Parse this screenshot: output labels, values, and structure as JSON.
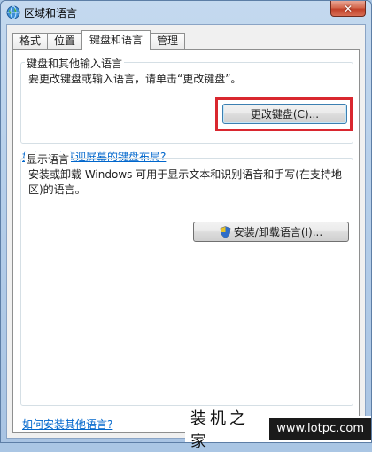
{
  "window": {
    "title": "区域和语言",
    "close_glyph": "✕"
  },
  "tabs": [
    {
      "label": "格式",
      "active": false
    },
    {
      "label": "位置",
      "active": false
    },
    {
      "label": "键盘和语言",
      "active": true
    },
    {
      "label": "管理",
      "active": false
    }
  ],
  "keyboard_group": {
    "title": "键盘和其他输入语言",
    "description": "要更改键盘或输入语言，请单击“更改键盘”。",
    "change_button": "更改键盘(C)...",
    "link": "如何更改欢迎屏幕的键盘布局?"
  },
  "display_group": {
    "title": "显示语言",
    "description": "安装或卸载 Windows 可用于显示文本和识别语音和手写(在支持地区)的语言。",
    "install_button": "安装/卸载语言(I)..."
  },
  "footer_link": "如何安装其他语言?",
  "watermark": {
    "brand": "装机之家",
    "url": "www.lotpc.com"
  },
  "colors": {
    "highlight": "#d9272f",
    "link": "#0066cc"
  }
}
